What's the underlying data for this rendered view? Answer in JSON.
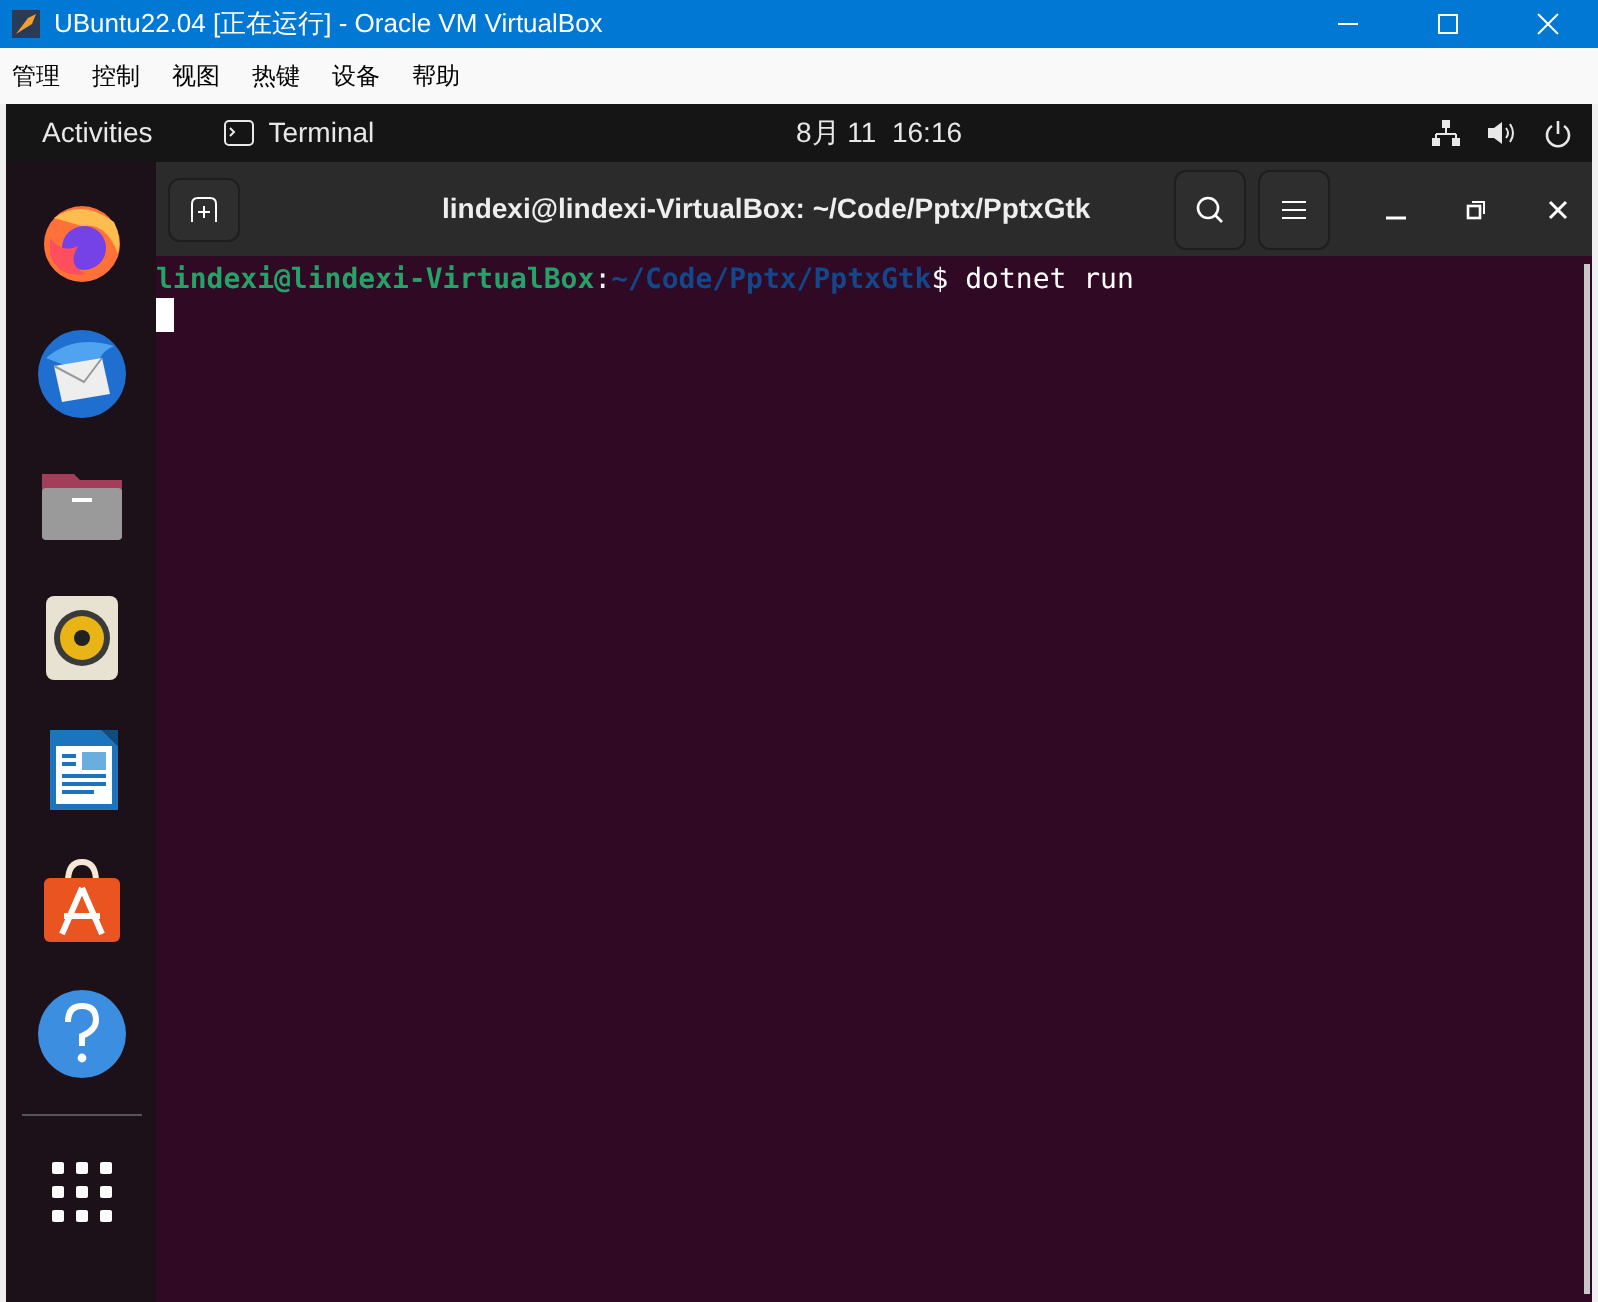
{
  "window": {
    "title": "UBuntu22.04 [正在运行] - Oracle VM VirtualBox"
  },
  "menu": [
    "管理",
    "控制",
    "视图",
    "热键",
    "设备",
    "帮助"
  ],
  "top_bar": {
    "activities": "Activities",
    "app": "Terminal",
    "clock": "8月 11  16:16"
  },
  "dock": [
    {
      "kind": "firefox"
    },
    {
      "kind": "mail"
    },
    {
      "kind": "files"
    },
    {
      "kind": "speaker"
    },
    {
      "kind": "writer"
    },
    {
      "kind": "store"
    },
    {
      "kind": "help"
    }
  ],
  "terminal": {
    "title": "lindexi@lindexi-VirtualBox: ~/Code/Pptx/PptxGtk",
    "lines": [
      {
        "user_host": "lindexi@lindexi-VirtualBox",
        "sep": ":",
        "path": "~/Code/Pptx/PptxGtk",
        "prompt": "$",
        "command": " dotnet run"
      }
    ]
  }
}
